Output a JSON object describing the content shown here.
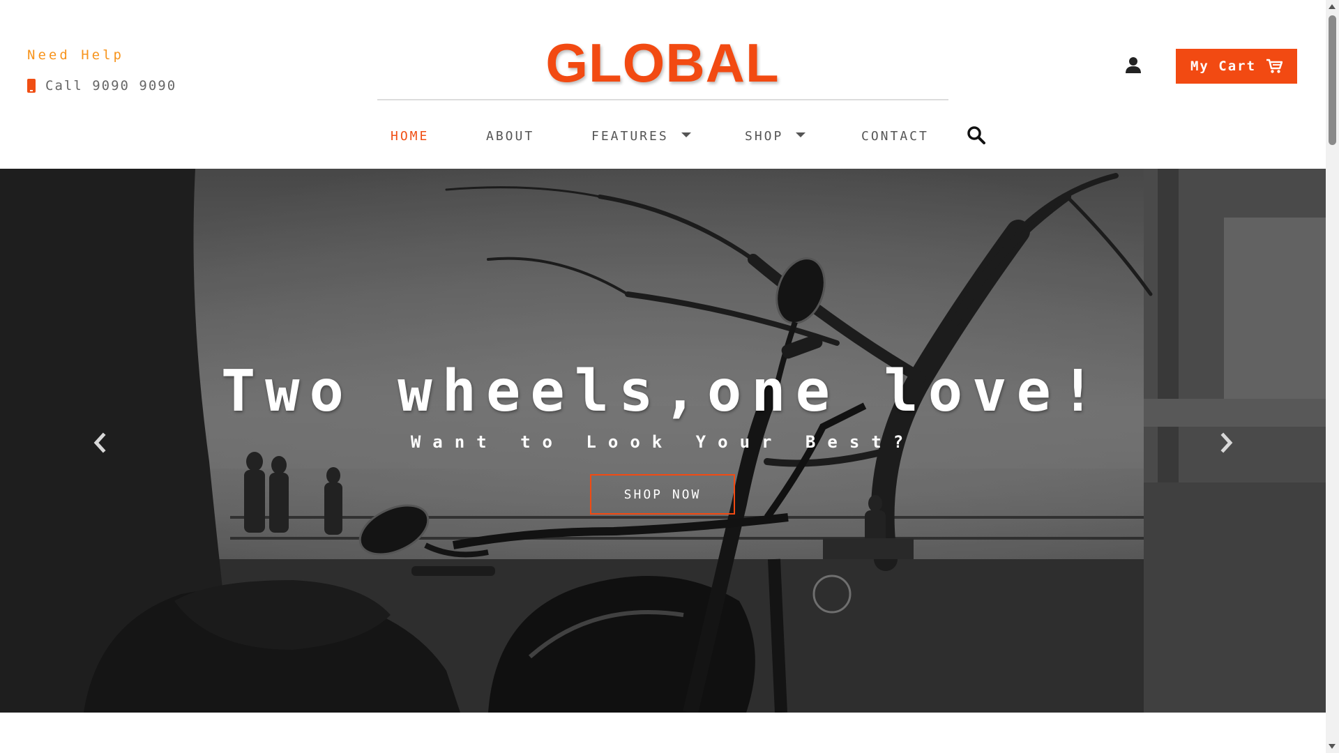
{
  "colors": {
    "accent": "#f24a12",
    "help": "#f7941d",
    "nav_text": "#555555"
  },
  "header": {
    "help_title": "Need Help",
    "help_phone": "Call 9090 9090",
    "logo": "GLOBAL",
    "cart_label": "My Cart"
  },
  "nav": {
    "home": "HOME",
    "about": "ABOUT",
    "features": "FEATURES",
    "shop": "SHOP",
    "contact": "CONTACT"
  },
  "hero": {
    "title": "Two wheels,one love!",
    "subtitle": "Want to Look Your Best?",
    "cta": "SHOP NOW"
  },
  "icons": {
    "phone": "phone-icon",
    "search": "search-icon",
    "user": "user-icon",
    "cart": "cart-icon",
    "prev": "chevron-left-icon",
    "next": "chevron-right-icon"
  }
}
